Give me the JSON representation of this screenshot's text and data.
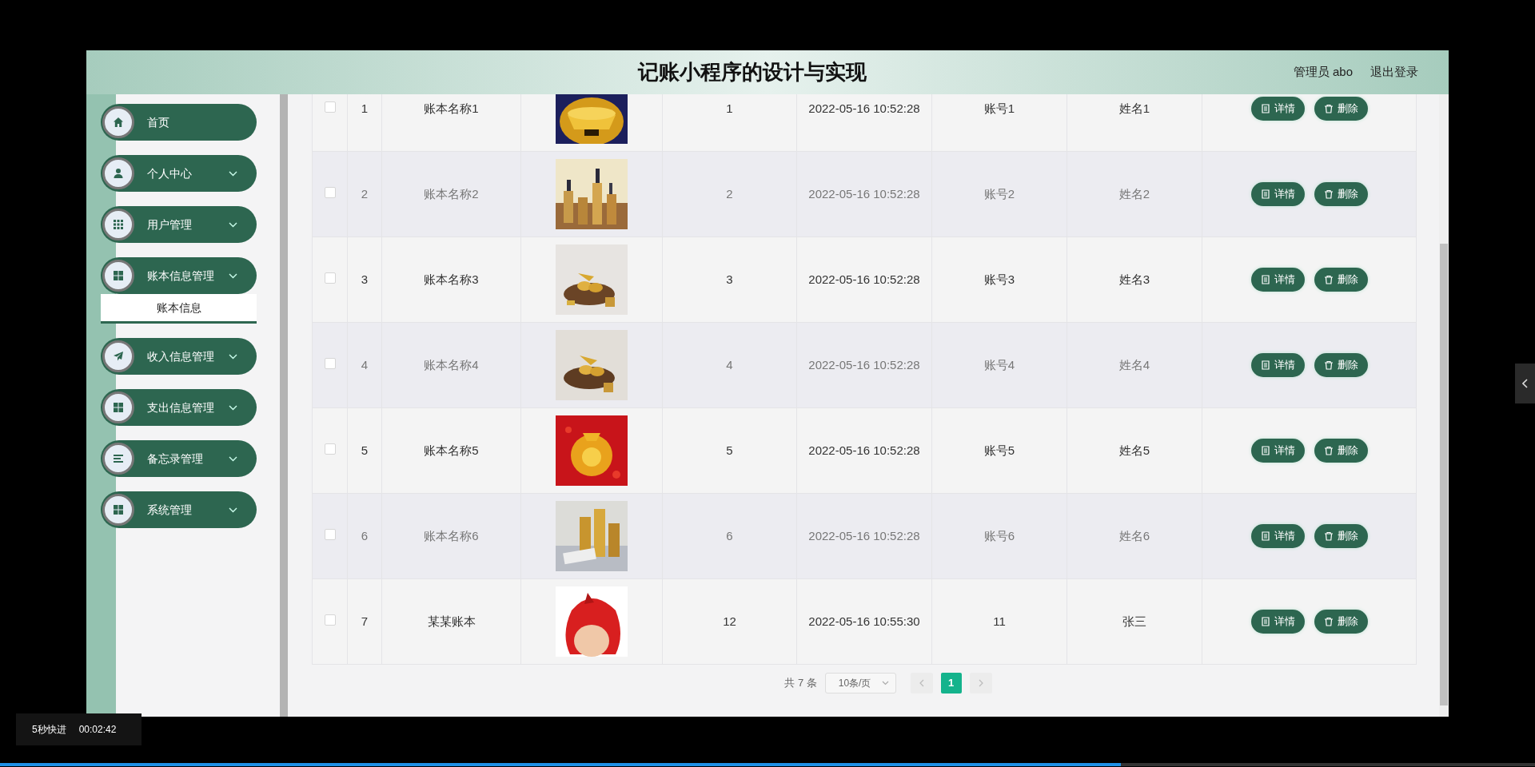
{
  "header": {
    "title": "记账小程序的设计与实现",
    "user": "管理员 abo",
    "logout": "退出登录"
  },
  "sidebar": {
    "items": [
      {
        "label": "首页",
        "kind": "link"
      },
      {
        "label": "个人中心",
        "kind": "group"
      },
      {
        "label": "用户管理",
        "kind": "group"
      },
      {
        "label": "账本信息管理",
        "kind": "group",
        "children": [
          {
            "label": "账本信息",
            "selected": true
          }
        ]
      },
      {
        "label": "收入信息管理",
        "kind": "group"
      },
      {
        "label": "支出信息管理",
        "kind": "group"
      },
      {
        "label": "备忘录管理",
        "kind": "group"
      },
      {
        "label": "系统管理",
        "kind": "group"
      }
    ]
  },
  "table": {
    "rows": [
      {
        "checked": false,
        "cells": [
          "1",
          "账本名称1",
          "1",
          "2022-05-16 10:52:28",
          "账号1",
          "姓名1"
        ],
        "actions": [
          "详情",
          "删除"
        ]
      },
      {
        "checked": false,
        "cells": [
          "2",
          "账本名称2",
          "2",
          "2022-05-16 10:52:28",
          "账号2",
          "姓名2"
        ],
        "actions": [
          "详情",
          "删除"
        ]
      },
      {
        "checked": false,
        "cells": [
          "3",
          "账本名称3",
          "3",
          "2022-05-16 10:52:28",
          "账号3",
          "姓名3"
        ],
        "actions": [
          "详情",
          "删除"
        ]
      },
      {
        "checked": false,
        "cells": [
          "4",
          "账本名称4",
          "4",
          "2022-05-16 10:52:28",
          "账号4",
          "姓名4"
        ],
        "actions": [
          "详情",
          "删除"
        ]
      },
      {
        "checked": false,
        "cells": [
          "5",
          "账本名称5",
          "5",
          "2022-05-16 10:52:28",
          "账号5",
          "姓名5"
        ],
        "actions": [
          "详情",
          "删除"
        ]
      },
      {
        "checked": false,
        "cells": [
          "6",
          "账本名称6",
          "6",
          "2022-05-16 10:52:28",
          "账号6",
          "姓名6"
        ],
        "actions": [
          "详情",
          "删除"
        ]
      },
      {
        "checked": false,
        "cells": [
          "7",
          "某某账本",
          "12",
          "2022-05-16 10:55:30",
          "11",
          "张三"
        ],
        "actions": [
          "详情",
          "删除"
        ]
      }
    ]
  },
  "pagination": {
    "total": "共 7 条",
    "page_size": "10条/页",
    "pages": [
      {
        "label": "1",
        "selected": true
      }
    ]
  },
  "player": {
    "skip_label": "5秒快进",
    "time": "00:02:42",
    "level": 0.73
  }
}
